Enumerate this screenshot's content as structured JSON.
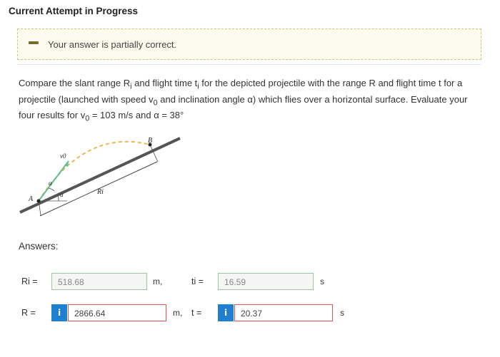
{
  "page": {
    "title": "Current Attempt in Progress"
  },
  "status": {
    "text": "Your answer is partially correct.",
    "icon": "minus-icon",
    "color": "#d6c17a"
  },
  "question": {
    "line1": "Compare the slant range R",
    "line1_sub": "i",
    "line1b": " and flight time t",
    "line1b_sub": "i",
    "line1c": " for the depicted projectile with the range R and flight time t for a",
    "line2": "projectile (launched with speed v",
    "line2_sub": "0",
    "line2b": " and inclination angle α) which flies over a horizontal surface. Evaluate your",
    "line3": "four results for v",
    "line3_sub": "0",
    "line3b": " = 103 m/s and α = 38°"
  },
  "figure": {
    "label_A": "A",
    "label_B": "B",
    "label_v0": "v0",
    "label_alpha_top": "α",
    "label_alpha_bottom": "α",
    "label_Ri": "Ri"
  },
  "answers": {
    "heading": "Answers:",
    "Ri": {
      "label": "Ri =",
      "value": "518.68",
      "unit": "m,",
      "state": "correct"
    },
    "ti": {
      "label": "ti =",
      "value": "16.59",
      "unit": "s",
      "state": "correct"
    },
    "R": {
      "label": "R =",
      "value": "2866.64",
      "unit": "m,",
      "state": "wrong",
      "info": "i"
    },
    "t": {
      "label": "t =",
      "value": "20.37",
      "unit": "s",
      "state": "wrong",
      "info": "i"
    }
  },
  "colors": {
    "correct_border": "#9ec79e",
    "wrong_border": "#d9534f",
    "info_button": "#1f7fd1"
  }
}
